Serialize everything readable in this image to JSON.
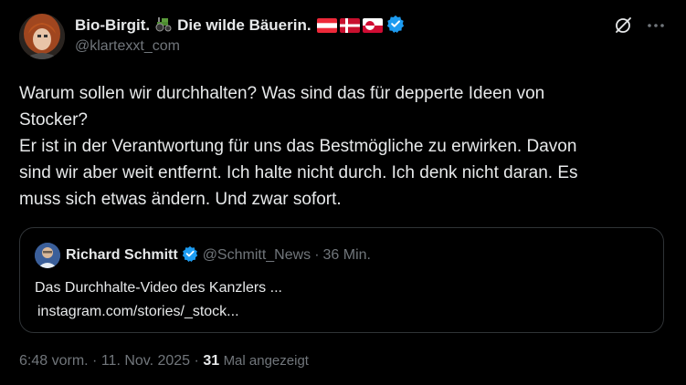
{
  "author": {
    "display_name": "Bio-Birgit.",
    "name_suffix": "Die wilde Bäuerin.",
    "handle": "@klartexxt_com",
    "emoji_icon": "tractor-emoji",
    "flags": [
      "austria-flag",
      "denmark-flag",
      "greenland-flag"
    ],
    "verified_color": "#1d9bf0"
  },
  "tweet": {
    "lines": [
      "Warum sollen wir durchhalten? Was sind das für depperte Ideen von",
      "Stocker?",
      "Er ist in der Verantwortung für uns das Bestmögliche zu erwirken. Davon",
      "sind wir aber weit entfernt. Ich halte nicht durch. Ich denk nicht daran. Es",
      "muss sich etwas ändern. Und zwar sofort."
    ]
  },
  "quote": {
    "display_name": "Richard Schmitt",
    "handle": "@Schmitt_News",
    "separator": "·",
    "time": "36 Min.",
    "text": "Das Durchhalte-Video des Kanzlers ...",
    "link": "instagram.com/stories/_stock..."
  },
  "meta": {
    "time": "6:48 vorm.",
    "separator": "·",
    "date": "11. Nov. 2025",
    "views_count": "31",
    "views_label": "Mal angezeigt"
  },
  "icons": {
    "grok": "grok-icon",
    "more": "more-options-icon"
  },
  "colors": {
    "background": "#000000",
    "text": "#e7e9ea",
    "muted": "#71767b",
    "border": "#2f3336",
    "verified": "#1d9bf0"
  }
}
